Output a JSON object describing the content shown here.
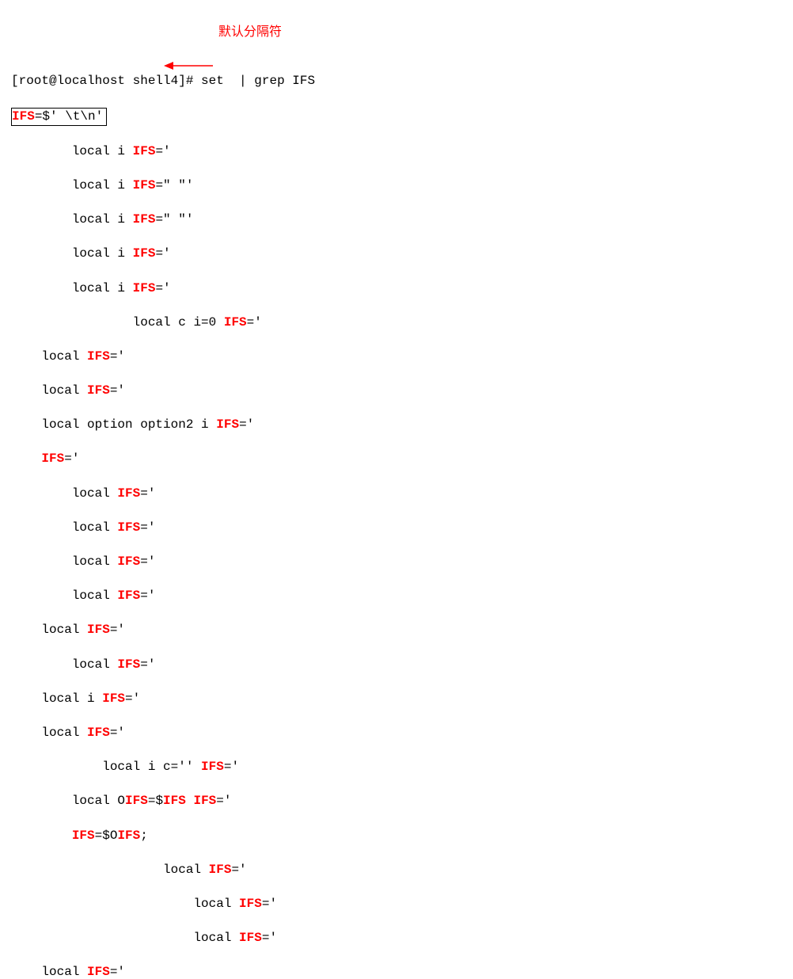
{
  "prompt": {
    "prefix": "[root@localhost shell4]# ",
    "command": "set  | grep IFS"
  },
  "boxed": {
    "kw": "IFS",
    "rest": "=$' \\t\\n'"
  },
  "annotation": "默认分隔符",
  "lines": [
    {
      "indent": "        ",
      "pre": "local i ",
      "kw": "IFS",
      "post": "='"
    },
    {
      "indent": "        ",
      "pre": "local i ",
      "kw": "IFS",
      "post": "=\" \"'"
    },
    {
      "indent": "        ",
      "pre": "local i ",
      "kw": "IFS",
      "post": "=\" \"'"
    },
    {
      "indent": "        ",
      "pre": "local i ",
      "kw": "IFS",
      "post": "='"
    },
    {
      "indent": "        ",
      "pre": "local i ",
      "kw": "IFS",
      "post": "='"
    },
    {
      "indent": "                ",
      "pre": "local c i=0 ",
      "kw": "IFS",
      "post": "='"
    },
    {
      "indent": "    ",
      "pre": "local ",
      "kw": "IFS",
      "post": "='"
    },
    {
      "indent": "    ",
      "pre": "local ",
      "kw": "IFS",
      "post": "='"
    },
    {
      "indent": "    ",
      "pre": "local option option2 i ",
      "kw": "IFS",
      "post": "='"
    },
    {
      "indent": "    ",
      "pre": "",
      "kw": "IFS",
      "post": "='"
    },
    {
      "indent": "        ",
      "pre": "local ",
      "kw": "IFS",
      "post": "='"
    },
    {
      "indent": "        ",
      "pre": "local ",
      "kw": "IFS",
      "post": "='"
    },
    {
      "indent": "        ",
      "pre": "local ",
      "kw": "IFS",
      "post": "='"
    },
    {
      "indent": "        ",
      "pre": "local ",
      "kw": "IFS",
      "post": "='"
    },
    {
      "indent": "    ",
      "pre": "local ",
      "kw": "IFS",
      "post": "='"
    },
    {
      "indent": "        ",
      "pre": "local ",
      "kw": "IFS",
      "post": "='"
    },
    {
      "indent": "    ",
      "pre": "local i ",
      "kw": "IFS",
      "post": "='"
    },
    {
      "indent": "    ",
      "pre": "local ",
      "kw": "IFS",
      "post": "='"
    }
  ],
  "special": {
    "s1": {
      "indent": "            ",
      "pre": "local i c='' ",
      "kw": "IFS",
      "post": "='"
    },
    "s2": {
      "indent": "        ",
      "p1": "local O",
      "k1": "IFS",
      "p2": "=$",
      "k2": "IFS",
      "p3": " ",
      "k3": "IFS",
      "p4": "='"
    },
    "s3": {
      "indent": "        ",
      "k1": "IFS",
      "p1": "=$O",
      "k2": "IFS",
      "p2": ";"
    },
    "s4": {
      "indent": "                    ",
      "pre": "local ",
      "kw": "IFS",
      "post": "='"
    },
    "s5": {
      "indent": "                        ",
      "pre": "local ",
      "kw": "IFS",
      "post": "='"
    },
    "s6": {
      "indent": "                        ",
      "pre": "local ",
      "kw": "IFS",
      "post": "='"
    },
    "s7": {
      "indent": "    ",
      "pre": "local ",
      "kw": "IFS",
      "post": "='"
    }
  }
}
